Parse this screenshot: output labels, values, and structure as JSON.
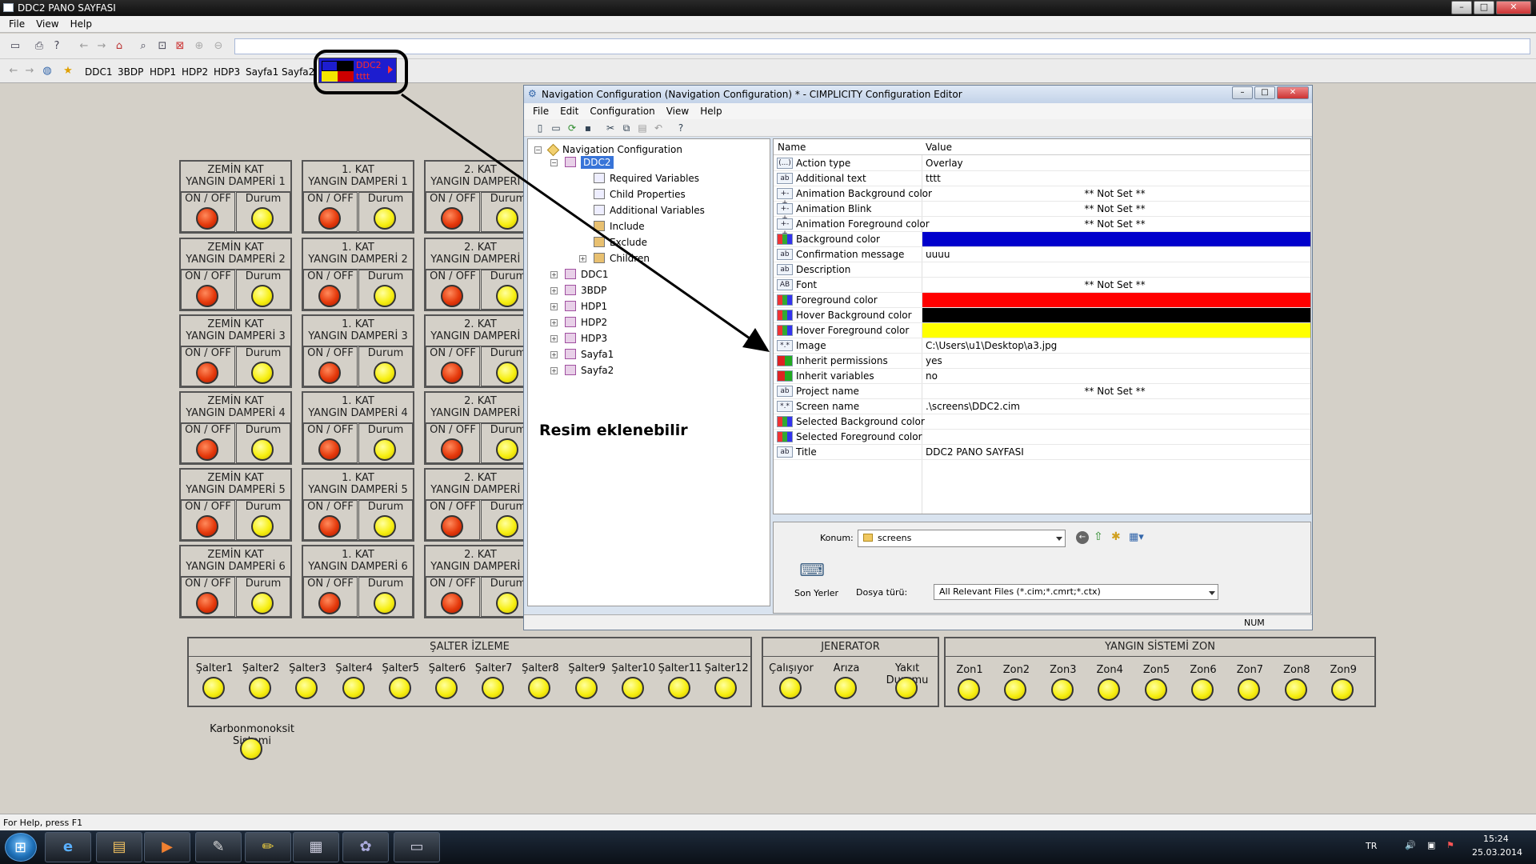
{
  "window": {
    "title": "DDC2 PANO SAYFASI"
  },
  "menu": [
    "File",
    "View",
    "Help"
  ],
  "nav": {
    "links": [
      "DDC1",
      "3BDP",
      "HDP1",
      "HDP2",
      "HDP3",
      "Sayfa1",
      "Sayfa2"
    ],
    "active_button": {
      "line1": "DDC2",
      "line2": "tttt"
    }
  },
  "panels": {
    "columns": [
      "ZEMİN KAT",
      "1. KAT",
      "2. KAT"
    ],
    "title_prefix": "YANGIN DAMPERİ",
    "numbers": [
      "1",
      "2",
      "3",
      "4",
      "5",
      "6"
    ],
    "cell_left": "ON / OFF",
    "cell_right": "Durum",
    "colors": {
      "on_off": "#e53a0c",
      "durum": "#f7ef12"
    }
  },
  "groups": {
    "salter": {
      "title": "ŞALTER İZLEME",
      "items": [
        "Şalter1",
        "Şalter2",
        "Şalter3",
        "Şalter4",
        "Şalter5",
        "Şalter6",
        "Şalter7",
        "Şalter8",
        "Şalter9",
        "Şalter10",
        "Şalter11",
        "Şalter12"
      ]
    },
    "jenerator": {
      "title": "JENERATOR",
      "items": [
        "Çalışıyor",
        "Arıza",
        "Yakıt Durumu"
      ]
    },
    "yangin": {
      "title": "YANGIN SİSTEMİ ZON",
      "items": [
        "Zon1",
        "Zon2",
        "Zon3",
        "Zon4",
        "Zon5",
        "Zon6",
        "Zon7",
        "Zon8",
        "Zon9"
      ]
    },
    "karbon": {
      "label": "Karbonmonoksit Sistemi"
    }
  },
  "statusbar": {
    "text": "For Help, press F1"
  },
  "taskbar": {
    "lang": "TR",
    "time": "15:24",
    "date": "25.03.2014"
  },
  "config_editor": {
    "title": "Navigation Configuration (Navigation Configuration) * - CIMPLICITY Configuration Editor",
    "menu": [
      "File",
      "Edit",
      "Configuration",
      "View",
      "Help"
    ],
    "tree": {
      "root": "Navigation Configuration",
      "selected": "DDC2",
      "children_of_selected": [
        "Required Variables",
        "Child Properties",
        "Additional Variables",
        "Include",
        "Exclude",
        "Children"
      ],
      "siblings": [
        "DDC1",
        "3BDP",
        "HDP1",
        "HDP2",
        "HDP3",
        "Sayfa1",
        "Sayfa2"
      ]
    },
    "annotation": "Resim eklenebilir",
    "props": {
      "col_name": "Name",
      "col_value": "Value",
      "rows": [
        {
          "icon": "(...)",
          "name": "Action type",
          "value": "Overlay"
        },
        {
          "icon": "ab",
          "name": "Additional text",
          "value": "tttt"
        },
        {
          "icon": "+-+",
          "name": "Animation Background color",
          "value": "** Not Set **"
        },
        {
          "icon": "+-+",
          "name": "Animation Blink",
          "value": "** Not Set **"
        },
        {
          "icon": "+-+",
          "name": "Animation Foreground color",
          "value": "** Not Set **"
        },
        {
          "icon": "grid",
          "name": "Background color",
          "value": "",
          "color": "#0000cc"
        },
        {
          "icon": "ab",
          "name": "Confirmation message",
          "value": "uuuu"
        },
        {
          "icon": "ab",
          "name": "Description",
          "value": ""
        },
        {
          "icon": "AB",
          "name": "Font",
          "value": "** Not Set **"
        },
        {
          "icon": "grid",
          "name": "Foreground color",
          "value": "",
          "color": "#ff0000"
        },
        {
          "icon": "grid",
          "name": "Hover Background color",
          "value": "",
          "color": "#000000"
        },
        {
          "icon": "grid",
          "name": "Hover Foreground color",
          "value": "",
          "color": "#ffff00"
        },
        {
          "icon": "*.*",
          "name": "Image",
          "value": "C:\\Users\\u1\\Desktop\\a3.jpg"
        },
        {
          "icon": "toggle",
          "name": "Inherit permissions",
          "value": "yes"
        },
        {
          "icon": "toggle",
          "name": "Inherit variables",
          "value": "no"
        },
        {
          "icon": "ab",
          "name": "Project name",
          "value": "** Not Set **"
        },
        {
          "icon": "*.*",
          "name": "Screen name",
          "value": ".\\screens\\DDC2.cim"
        },
        {
          "icon": "grid",
          "name": "Selected Background color",
          "value": ""
        },
        {
          "icon": "grid",
          "name": "Selected Foreground color",
          "value": ""
        },
        {
          "icon": "ab",
          "name": "Title",
          "value": "DDC2 PANO SAYFASI"
        }
      ]
    },
    "file": {
      "konum_label": "Konum:",
      "konum_value": "screens",
      "recent_label": "Son Yerler",
      "type_label": "Dosya türü:",
      "type_value": "All Relevant Files (*.cim;*.cmrt;*.ctx)"
    },
    "status": "NUM"
  }
}
